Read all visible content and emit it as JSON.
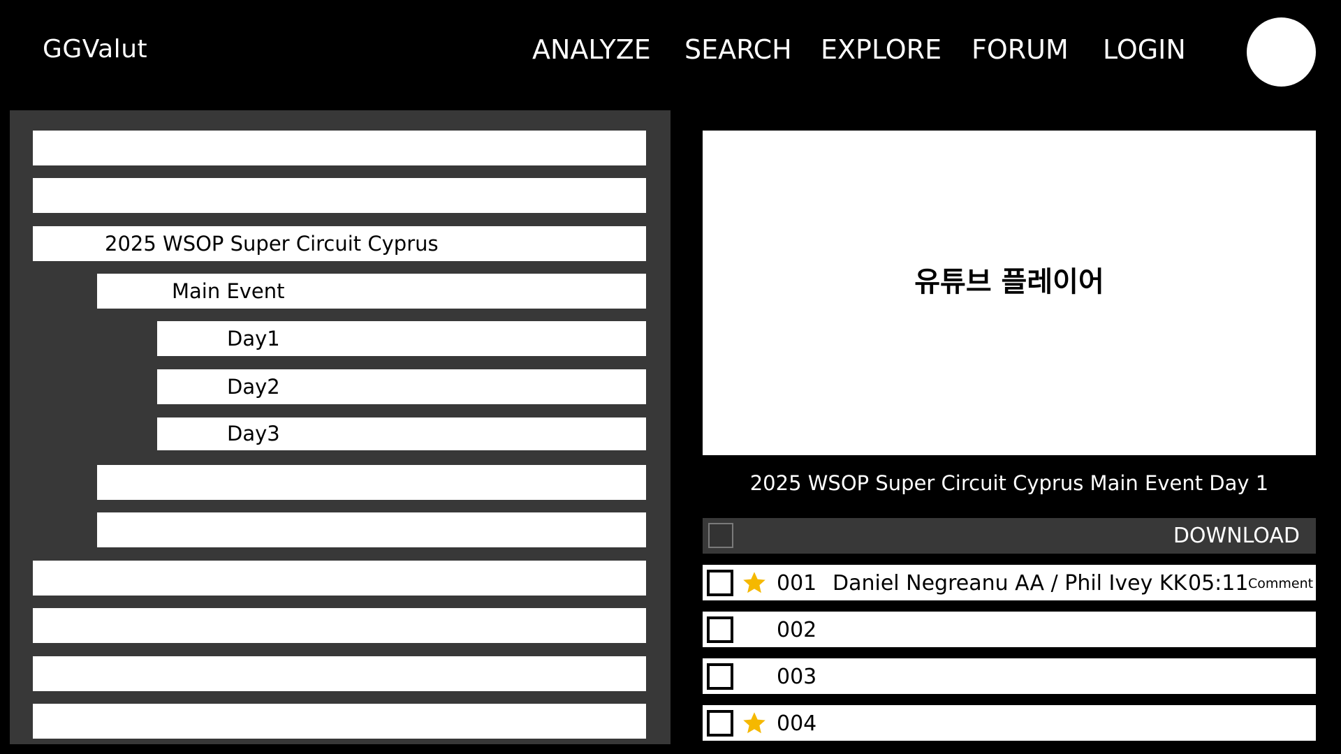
{
  "header": {
    "brand": "GGValut",
    "nav": [
      "ANALYZE",
      "SEARCH",
      "EXPLORE",
      "FORUM",
      "LOGIN"
    ]
  },
  "tree": {
    "rows": [
      {
        "label": "",
        "level": 0
      },
      {
        "label": "",
        "level": 0
      },
      {
        "label": "2025 WSOP Super Circuit Cyprus",
        "level": 0
      },
      {
        "label": "Main Event",
        "level": 1
      },
      {
        "label": "Day1",
        "level": 2
      },
      {
        "label": "Day2",
        "level": 2
      },
      {
        "label": "Day3",
        "level": 2
      },
      {
        "label": "",
        "level": 1
      },
      {
        "label": "",
        "level": 1
      },
      {
        "label": "",
        "level": 0
      },
      {
        "label": "",
        "level": 0
      },
      {
        "label": "",
        "level": 0
      },
      {
        "label": "",
        "level": 0
      }
    ]
  },
  "player": {
    "label": "유튜브 플레이어"
  },
  "video": {
    "title": "2025 WSOP Super Circuit Cyprus Main Event Day 1"
  },
  "download": {
    "label": "DOWNLOAD"
  },
  "hands": [
    {
      "num": "001",
      "starred": true,
      "players": "Daniel Negreanu AA / Phil Ivey KK",
      "time": "05:11",
      "comment": "Comment"
    },
    {
      "num": "002",
      "starred": false,
      "players": "",
      "time": "",
      "comment": ""
    },
    {
      "num": "003",
      "starred": false,
      "players": "",
      "time": "",
      "comment": ""
    },
    {
      "num": "004",
      "starred": true,
      "players": "",
      "time": "",
      "comment": ""
    }
  ],
  "colors": {
    "background": "#000000",
    "panel": "#383838",
    "row": "#ffffff",
    "star": "#f5b800"
  }
}
